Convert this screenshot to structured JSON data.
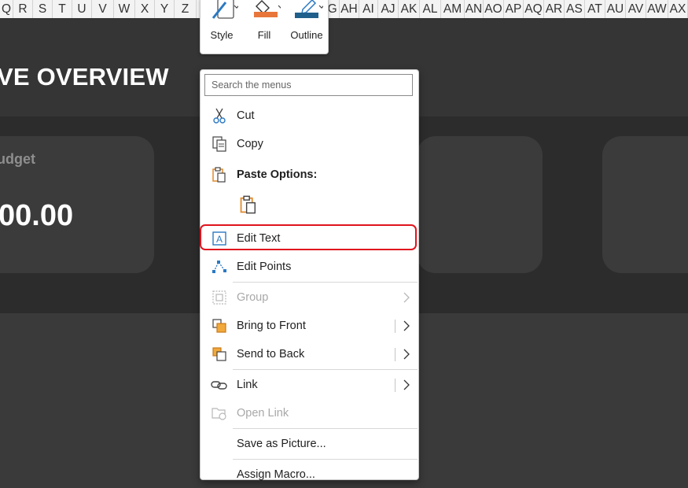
{
  "columns": [
    "Q",
    "R",
    "S",
    "T",
    "U",
    "V",
    "W",
    "X",
    "Y",
    "Z",
    "AG",
    "AH",
    "AI",
    "AJ",
    "AK",
    "AL",
    "AM",
    "AN",
    "AO",
    "AP",
    "AQ",
    "AR",
    "AS",
    "AT",
    "AU",
    "AV",
    "AW",
    "AX"
  ],
  "dashboard": {
    "title": "VE OVERVIEW",
    "card_label": "udget",
    "card_value": "00.00"
  },
  "mini_toolbar": {
    "style_label": "Style",
    "fill_label": "Fill",
    "outline_label": "Outline",
    "fill_color": "#e8763a",
    "outline_color": "#1f5f8b"
  },
  "context_menu": {
    "search_placeholder": "Search the menus",
    "items": [
      {
        "label": "Cut",
        "icon": "scissors-icon"
      },
      {
        "label": "Copy",
        "icon": "copy-icon"
      },
      {
        "label": "Paste Options:",
        "icon": "clipboard-icon"
      },
      {
        "label": "Edit Text",
        "icon": "edit-text-icon"
      },
      {
        "label": "Edit Points",
        "icon": "edit-points-icon"
      },
      {
        "label": "Group",
        "icon": "group-icon"
      },
      {
        "label": "Bring to Front",
        "icon": "bring-to-front-icon"
      },
      {
        "label": "Send to Back",
        "icon": "send-to-back-icon"
      },
      {
        "label": "Link",
        "icon": "link-icon"
      },
      {
        "label": "Open Link",
        "icon": "open-link-icon"
      },
      {
        "label": "Save as Picture...",
        "icon": ""
      },
      {
        "label": "Assign Macro...",
        "icon": ""
      }
    ]
  }
}
